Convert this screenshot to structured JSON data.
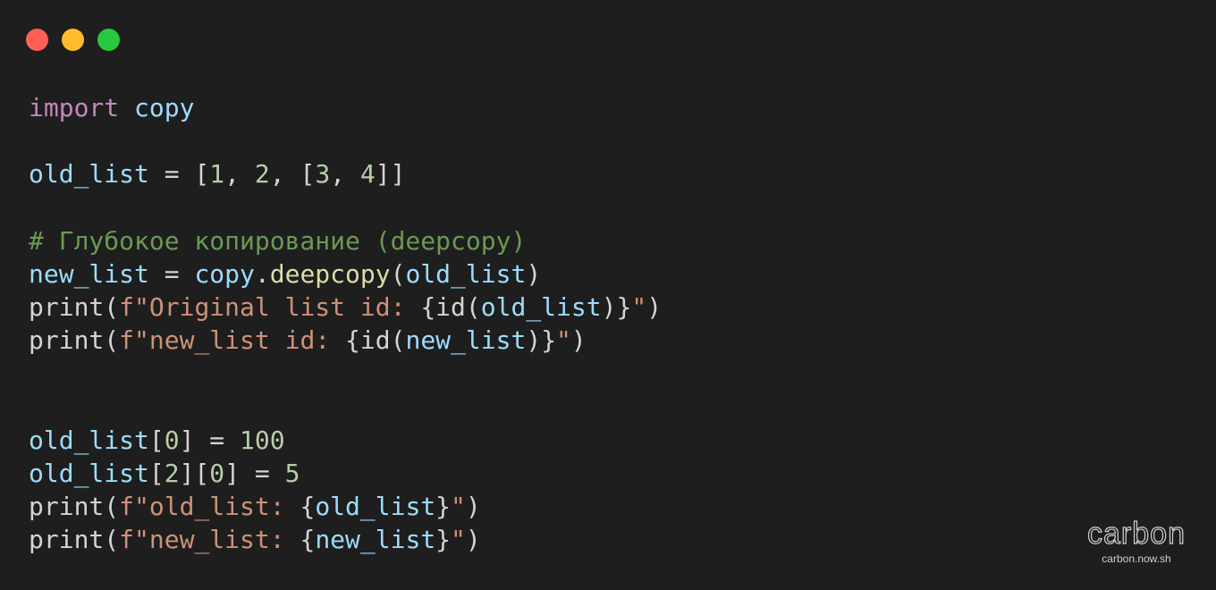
{
  "window": {
    "controls": [
      "close",
      "minimize",
      "maximize"
    ]
  },
  "code": {
    "l1": {
      "kw": "import",
      "mod": "copy"
    },
    "l3": {
      "var": "old_list",
      "op": " = [",
      "n1": "1",
      "s1": ", ",
      "n2": "2",
      "s2": ", [",
      "n3": "3",
      "s3": ", ",
      "n4": "4",
      "end": "]]"
    },
    "l5": {
      "comment": "# Глубокое копирование (deepcopy)"
    },
    "l6": {
      "var": "new_list",
      "op": " = ",
      "mod": "copy",
      "dot": ".",
      "fn": "deepcopy",
      "p1": "(",
      "arg": "old_list",
      "p2": ")"
    },
    "l7": {
      "fn": "print",
      "p1": "(",
      "str1": "f\"Original list id: ",
      "br1": "{",
      "fn2": "id",
      "p2": "(",
      "arg": "old_list",
      "p3": ")",
      "br2": "}",
      "str2": "\"",
      "p4": ")"
    },
    "l8": {
      "fn": "print",
      "p1": "(",
      "str1": "f\"new_list id: ",
      "br1": "{",
      "fn2": "id",
      "p2": "(",
      "arg": "new_list",
      "p3": ")",
      "br2": "}",
      "str2": "\"",
      "p4": ")"
    },
    "l11": {
      "var": "old_list",
      "b1": "[",
      "idx": "0",
      "b2": "] = ",
      "num": "100"
    },
    "l12": {
      "var": "old_list",
      "b1": "[",
      "idx1": "2",
      "b2": "][",
      "idx2": "0",
      "b3": "] = ",
      "num": "5"
    },
    "l13": {
      "fn": "print",
      "p1": "(",
      "str1": "f\"old_list: ",
      "br1": "{",
      "arg": "old_list",
      "br2": "}",
      "str2": "\"",
      "p2": ")"
    },
    "l14": {
      "fn": "print",
      "p1": "(",
      "str1": "f\"new_list: ",
      "br1": "{",
      "arg": "new_list",
      "br2": "}",
      "str2": "\"",
      "p2": ")"
    }
  },
  "brand": {
    "logo": "carbon",
    "url": "carbon.now.sh"
  }
}
